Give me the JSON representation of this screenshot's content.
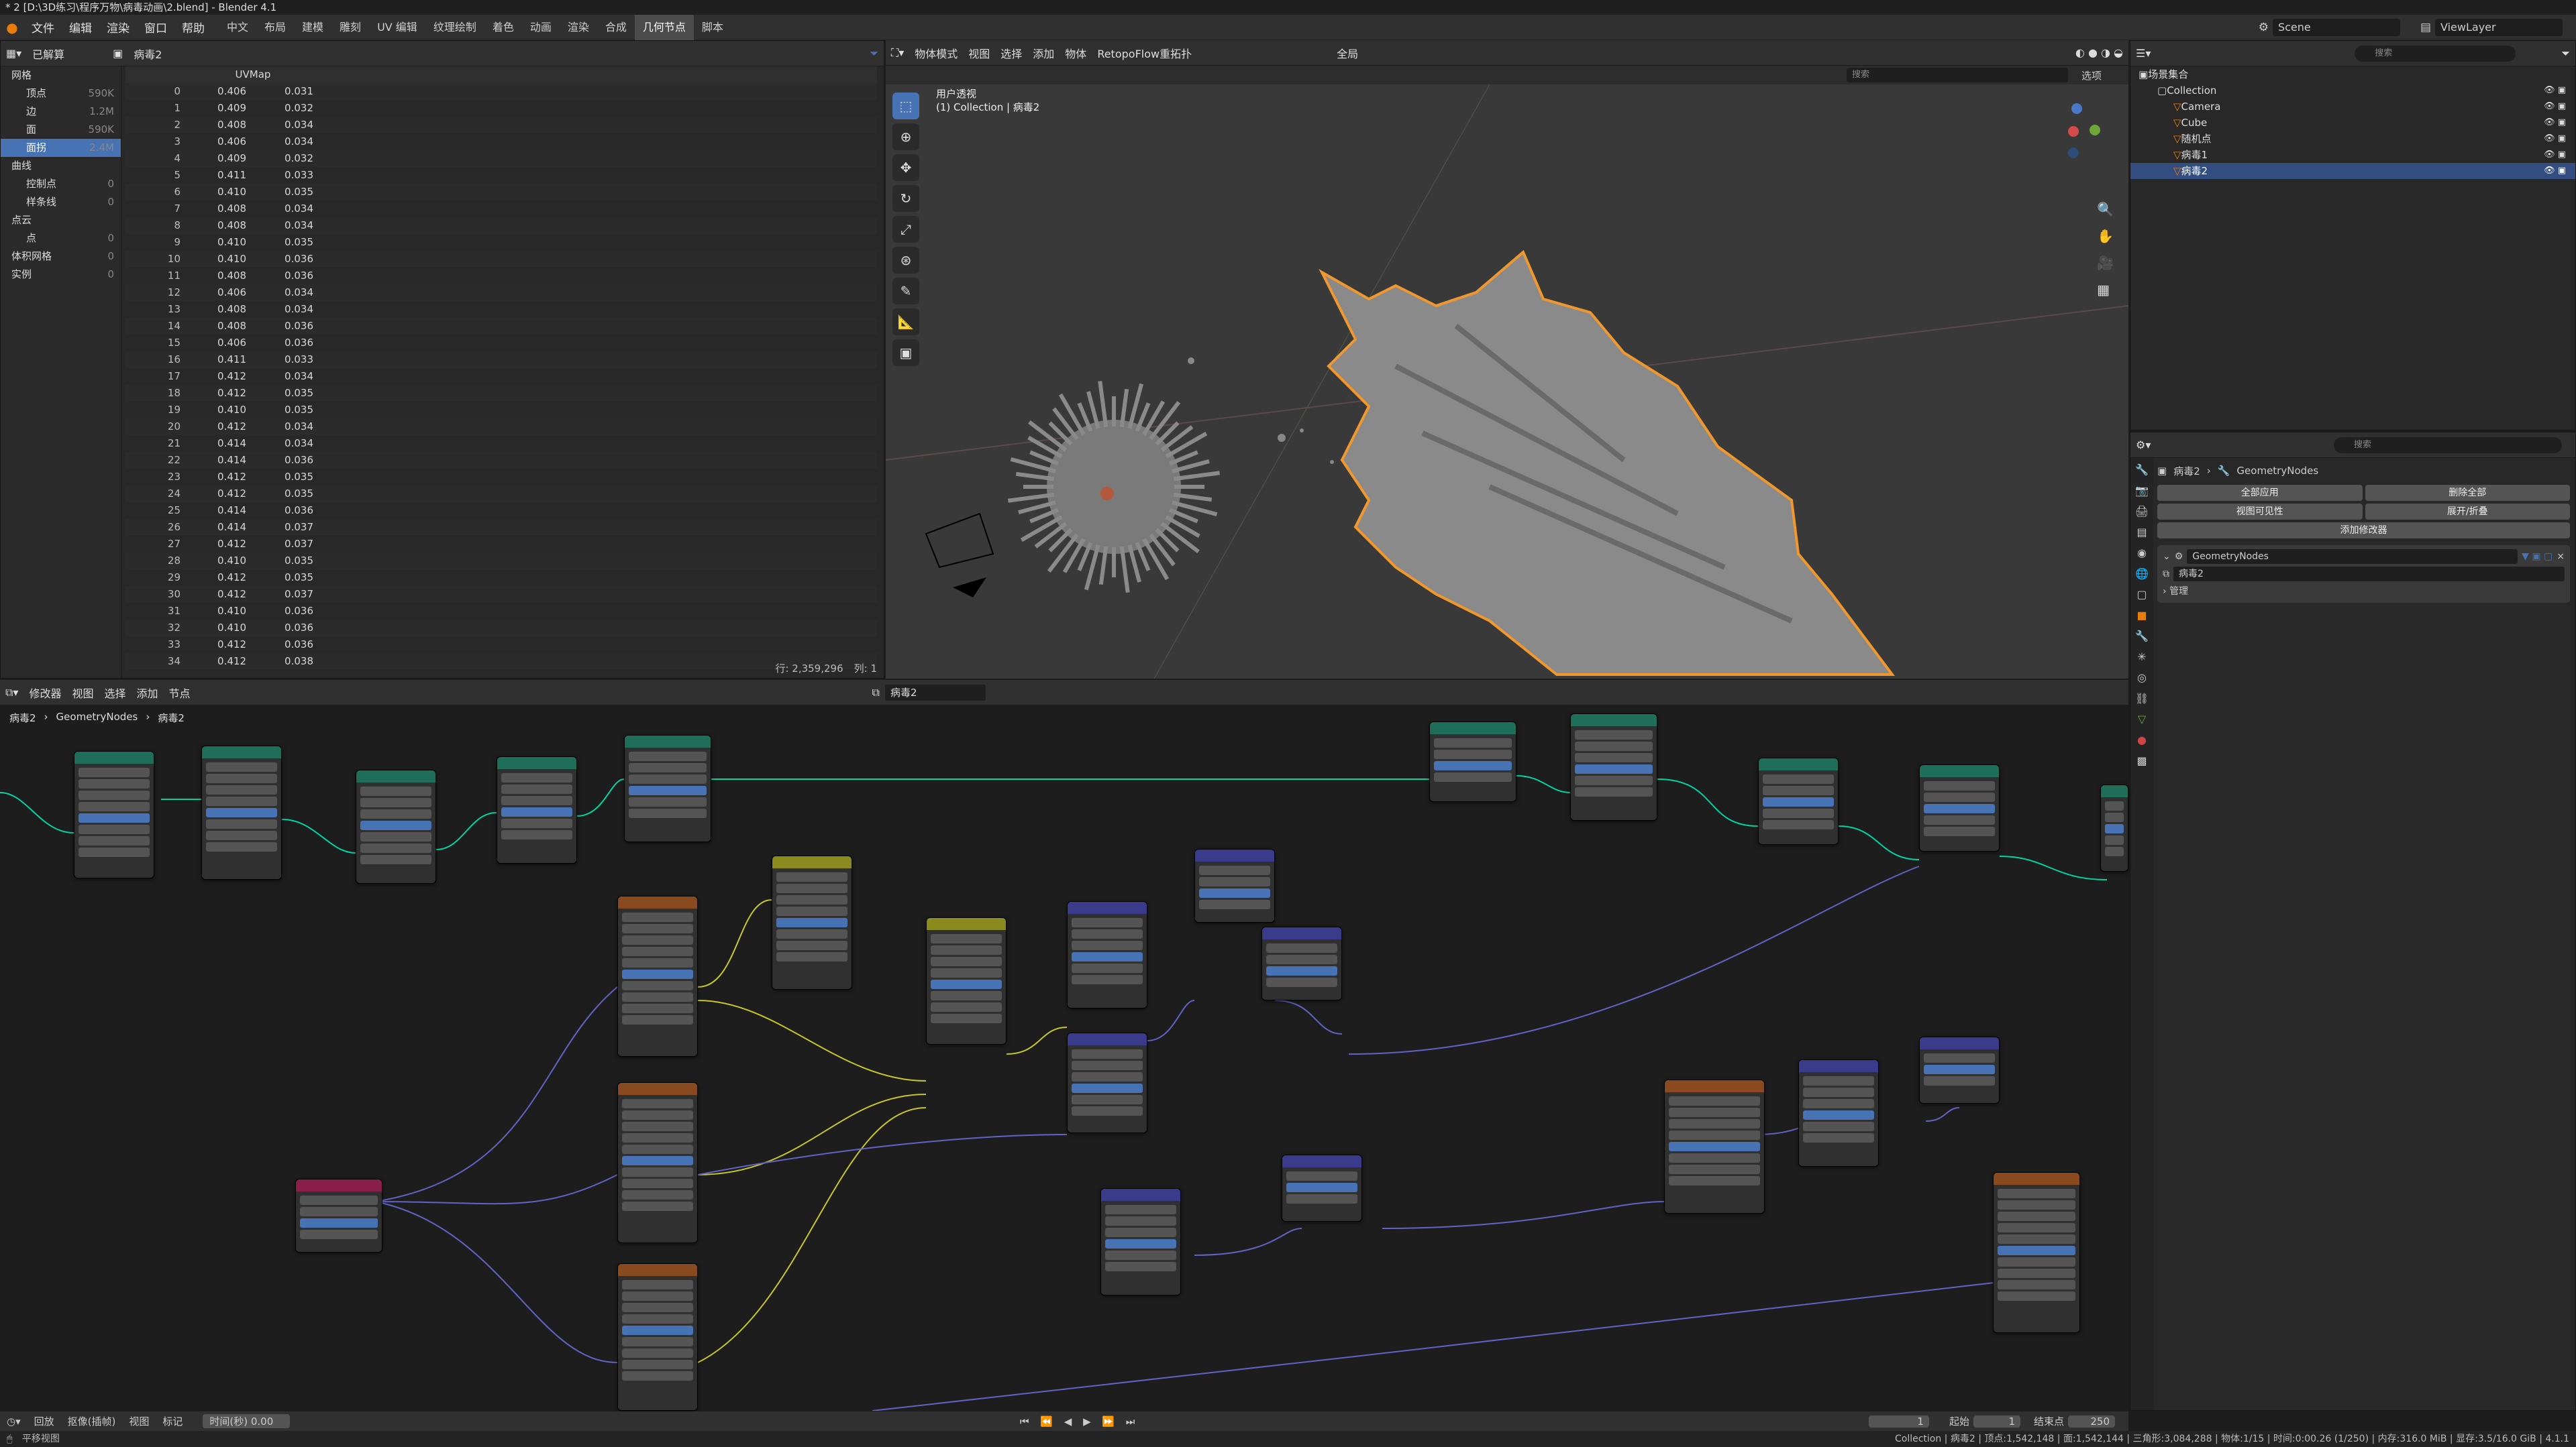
{
  "title": "* 2 [D:\\3D练习\\程序万物\\病毒动画\\2.blend] - Blender 4.1",
  "menus": [
    "文件",
    "编辑",
    "渲染",
    "窗口",
    "帮助"
  ],
  "workspaces": [
    "中文",
    "布局",
    "建模",
    "雕刻",
    "UV 编辑",
    "纹理绘制",
    "着色",
    "动画",
    "渲染",
    "合成",
    "几何节点",
    "脚本"
  ],
  "active_workspace": "几何节点",
  "scene": "Scene",
  "view_layer": "ViewLayer",
  "spreadsheet": {
    "mode": "已解算",
    "object": "病毒2",
    "column_header": "UVMap",
    "tree": [
      {
        "label": "网格",
        "count": "",
        "level": 0
      },
      {
        "label": "顶点",
        "count": "590K",
        "level": 1
      },
      {
        "label": "边",
        "count": "1.2M",
        "level": 1
      },
      {
        "label": "面",
        "count": "590K",
        "level": 1
      },
      {
        "label": "面拐",
        "count": "2.4M",
        "level": 1,
        "selected": true
      },
      {
        "label": "曲线",
        "count": "",
        "level": 0
      },
      {
        "label": "控制点",
        "count": "0",
        "level": 1
      },
      {
        "label": "样条线",
        "count": "0",
        "level": 1
      },
      {
        "label": "点云",
        "count": "",
        "level": 0
      },
      {
        "label": "点",
        "count": "0",
        "level": 1
      },
      {
        "label": "体积网格",
        "count": "0",
        "level": 0
      },
      {
        "label": "实例",
        "count": "0",
        "level": 0
      }
    ],
    "rows": [
      [
        "0",
        "0.406",
        "0.031"
      ],
      [
        "1",
        "0.409",
        "0.032"
      ],
      [
        "2",
        "0.408",
        "0.034"
      ],
      [
        "3",
        "0.406",
        "0.034"
      ],
      [
        "4",
        "0.409",
        "0.032"
      ],
      [
        "5",
        "0.411",
        "0.033"
      ],
      [
        "6",
        "0.410",
        "0.035"
      ],
      [
        "7",
        "0.408",
        "0.034"
      ],
      [
        "8",
        "0.408",
        "0.034"
      ],
      [
        "9",
        "0.410",
        "0.035"
      ],
      [
        "10",
        "0.410",
        "0.036"
      ],
      [
        "11",
        "0.408",
        "0.036"
      ],
      [
        "12",
        "0.406",
        "0.034"
      ],
      [
        "13",
        "0.408",
        "0.034"
      ],
      [
        "14",
        "0.408",
        "0.036"
      ],
      [
        "15",
        "0.406",
        "0.036"
      ],
      [
        "16",
        "0.411",
        "0.033"
      ],
      [
        "17",
        "0.412",
        "0.034"
      ],
      [
        "18",
        "0.412",
        "0.035"
      ],
      [
        "19",
        "0.410",
        "0.035"
      ],
      [
        "20",
        "0.412",
        "0.034"
      ],
      [
        "21",
        "0.414",
        "0.034"
      ],
      [
        "22",
        "0.414",
        "0.036"
      ],
      [
        "23",
        "0.412",
        "0.035"
      ],
      [
        "24",
        "0.412",
        "0.035"
      ],
      [
        "25",
        "0.414",
        "0.036"
      ],
      [
        "26",
        "0.414",
        "0.037"
      ],
      [
        "27",
        "0.412",
        "0.037"
      ],
      [
        "28",
        "0.410",
        "0.035"
      ],
      [
        "29",
        "0.412",
        "0.035"
      ],
      [
        "30",
        "0.412",
        "0.037"
      ],
      [
        "31",
        "0.410",
        "0.036"
      ],
      [
        "32",
        "0.410",
        "0.036"
      ],
      [
        "33",
        "0.412",
        "0.036"
      ],
      [
        "34",
        "0.412",
        "0.038"
      ]
    ],
    "footer_rows": "行: 2,359,296",
    "footer_cols": "列: 1"
  },
  "viewport": {
    "header_items": [
      "物体模式",
      "视图",
      "选择",
      "添加",
      "物体",
      "RetopoFlow重拓扑"
    ],
    "transform": "全局",
    "search_placeholder": "搜索",
    "options": "选项",
    "overlay_title": "用户透视",
    "overlay_sub": "(1) Collection | 病毒2"
  },
  "outliner": {
    "search_placeholder": "搜索",
    "root": "场景集合",
    "items": [
      {
        "label": "Collection",
        "level": 0
      },
      {
        "label": "Camera",
        "level": 1
      },
      {
        "label": "Cube",
        "level": 1
      },
      {
        "label": "随机点",
        "level": 1
      },
      {
        "label": "病毒1",
        "level": 1
      },
      {
        "label": "病毒2",
        "level": 1,
        "selected": true
      }
    ]
  },
  "properties": {
    "search_placeholder": "搜索",
    "object": "病毒2",
    "modifier_tab": "GeometryNodes",
    "apply_all": "全部应用",
    "delete_all": "删除全部",
    "viewport_vis": "视图可见性",
    "expand": "展开/折叠",
    "add_modifier": "添加修改器",
    "modifier_name": "GeometryNodes",
    "nodetree": "病毒2",
    "manage": "管理"
  },
  "node_editor": {
    "header_items": [
      "修改器",
      "视图",
      "选择",
      "添加",
      "节点"
    ],
    "nodetree": "病毒2",
    "breadcrumb": [
      "病毒2",
      "GeometryNodes",
      "病毒2"
    ]
  },
  "timeline": {
    "items": [
      "回放",
      "抠像(插帧)",
      "视图",
      "标记"
    ],
    "time": "时间(秒) 0.00",
    "frame": "1",
    "start_label": "起始",
    "start": "1",
    "end_label": "结束点",
    "end": "250"
  },
  "status": {
    "left": "平移视图",
    "right": "Collection | 病毒2 | 顶点:1,542,148 | 面:1,542,144 | 三角形:3,084,288 | 物体:1/15 | 时间:0:00.26 (1/250) | 内存:316.0 MiB | 显存:3.5/16.0 GiB | 4.1.1"
  },
  "colors": {
    "accent": "#4772b3",
    "geo_header": "#1e6e5a",
    "tex_header": "#884a1e",
    "vec_header": "#3b3b8c",
    "mix_header": "#8a8a1e",
    "attr_header": "#8a1e4a"
  }
}
